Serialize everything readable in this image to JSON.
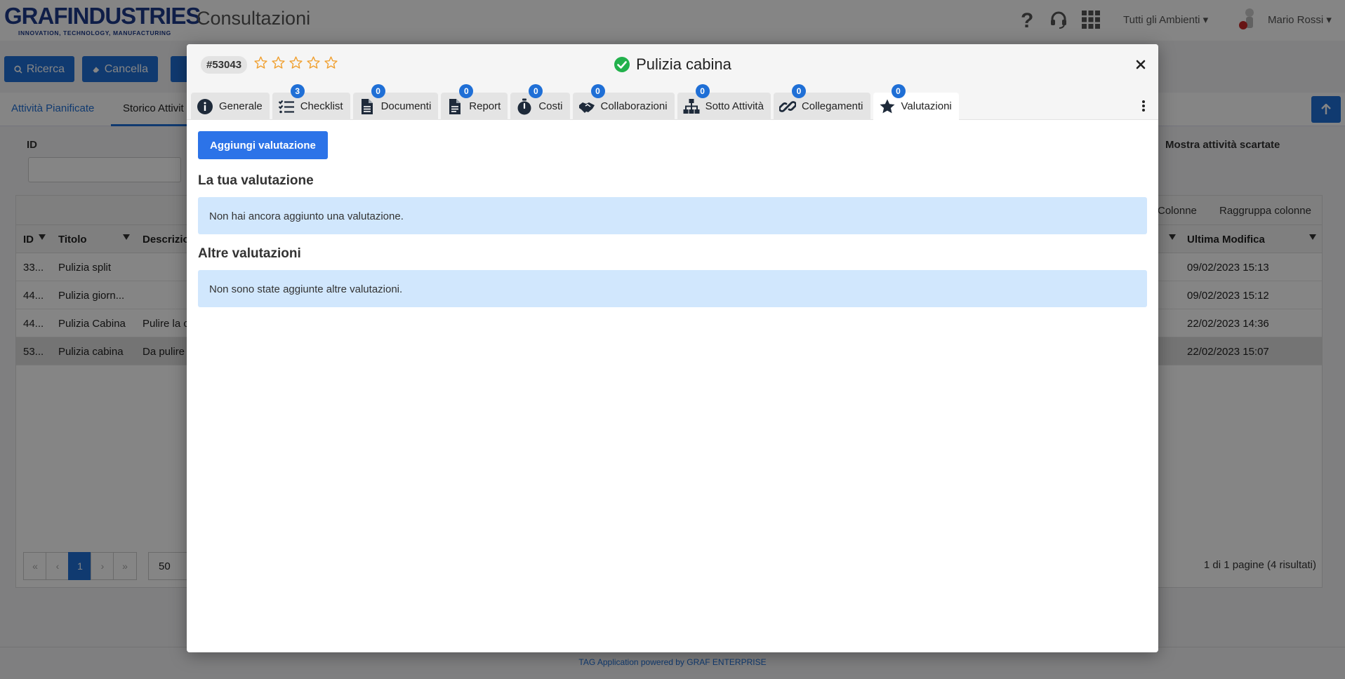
{
  "app": {
    "logo_text": "GRAFINDUSTRIES",
    "logo_tagline": "INNOVATION, TECHNOLOGY, MANUFACTURING",
    "title": "Consultazioni",
    "environment": "Tutti gli Ambienti",
    "user_name": "Mario Rossi"
  },
  "toolbar": {
    "search_label": "Ricerca",
    "clear_label": "Cancella"
  },
  "subnav": {
    "planned": "Attività Pianificate",
    "history": "Storico Attivit"
  },
  "filters": {
    "id_label": "ID",
    "show_discarded": "Mostra attività scartate"
  },
  "grid": {
    "columns_label": "Colonne",
    "group_label": "Raggruppa colonne",
    "headers": {
      "id": "ID",
      "title": "Titolo",
      "description": "Descrizio",
      "last_modified": "Ultima Modifica"
    },
    "rows": [
      {
        "id": "33...",
        "title": "Pulizia split",
        "description": "",
        "last_modified": "09/02/2023 15:13"
      },
      {
        "id": "44...",
        "title": "Pulizia giorn...",
        "description": "",
        "last_modified": "09/02/2023 15:12"
      },
      {
        "id": "44...",
        "title": "Pulizia Cabina",
        "description": "Pulire la c",
        "last_modified": "22/02/2023 14:36"
      },
      {
        "id": "53...",
        "title": "Pulizia cabina",
        "description": "Da pulire",
        "last_modified": "22/02/2023 15:07"
      }
    ],
    "current_page": "1",
    "page_size": "50",
    "pager_info": "1 di 1 pagine (4 risultati)"
  },
  "footer": "TAG Application powered by GRAF ENTERPRISE",
  "modal": {
    "id_badge": "#53043",
    "rating_stars": 0,
    "title": "Pulizia cabina",
    "tabs": [
      {
        "label": "Generale",
        "badge": ""
      },
      {
        "label": "Checklist",
        "badge": "3"
      },
      {
        "label": "Documenti",
        "badge": "0"
      },
      {
        "label": "Report",
        "badge": "0"
      },
      {
        "label": "Costi",
        "badge": "0"
      },
      {
        "label": "Collaborazioni",
        "badge": "0"
      },
      {
        "label": "Sotto Attività",
        "badge": "0"
      },
      {
        "label": "Collegamenti",
        "badge": "0"
      },
      {
        "label": "Valutazioni",
        "badge": "0"
      }
    ],
    "active_tab": "Valutazioni",
    "add_button": "Aggiungi valutazione",
    "your_rating_title": "La tua valutazione",
    "your_rating_empty": "Non hai ancora aggiunto una valutazione.",
    "other_ratings_title": "Altre valutazioni",
    "other_ratings_empty": "Non sono state aggiunte altre valutazioni."
  },
  "colors": {
    "primary": "#1f6fd6",
    "info_bg": "#d1e7fd",
    "success": "#22b14c",
    "star": "#f0a030"
  }
}
